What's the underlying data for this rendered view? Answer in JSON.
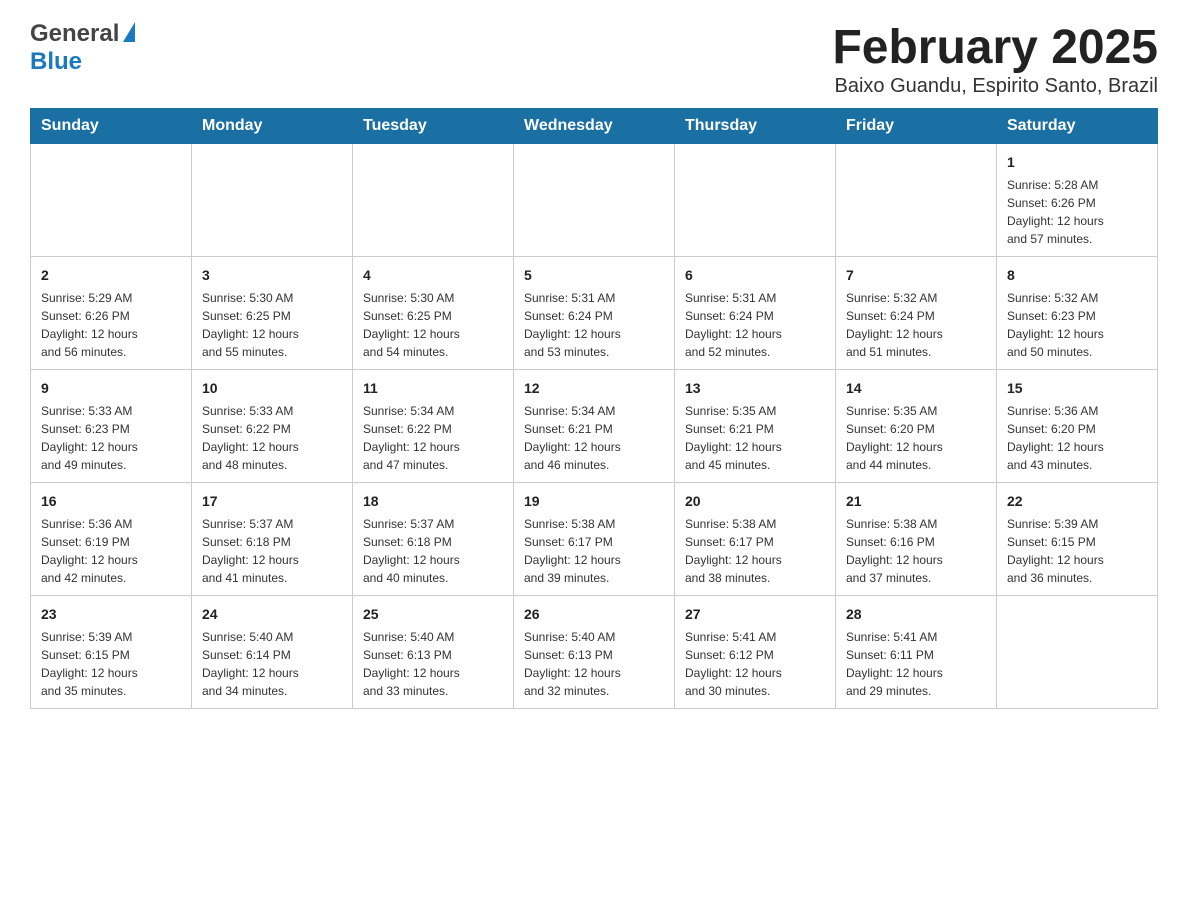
{
  "header": {
    "logo_general": "General",
    "logo_blue": "Blue",
    "title": "February 2025",
    "subtitle": "Baixo Guandu, Espirito Santo, Brazil"
  },
  "days_of_week": [
    "Sunday",
    "Monday",
    "Tuesday",
    "Wednesday",
    "Thursday",
    "Friday",
    "Saturday"
  ],
  "weeks": [
    [
      {
        "day": "",
        "info": ""
      },
      {
        "day": "",
        "info": ""
      },
      {
        "day": "",
        "info": ""
      },
      {
        "day": "",
        "info": ""
      },
      {
        "day": "",
        "info": ""
      },
      {
        "day": "",
        "info": ""
      },
      {
        "day": "1",
        "info": "Sunrise: 5:28 AM\nSunset: 6:26 PM\nDaylight: 12 hours\nand 57 minutes."
      }
    ],
    [
      {
        "day": "2",
        "info": "Sunrise: 5:29 AM\nSunset: 6:26 PM\nDaylight: 12 hours\nand 56 minutes."
      },
      {
        "day": "3",
        "info": "Sunrise: 5:30 AM\nSunset: 6:25 PM\nDaylight: 12 hours\nand 55 minutes."
      },
      {
        "day": "4",
        "info": "Sunrise: 5:30 AM\nSunset: 6:25 PM\nDaylight: 12 hours\nand 54 minutes."
      },
      {
        "day": "5",
        "info": "Sunrise: 5:31 AM\nSunset: 6:24 PM\nDaylight: 12 hours\nand 53 minutes."
      },
      {
        "day": "6",
        "info": "Sunrise: 5:31 AM\nSunset: 6:24 PM\nDaylight: 12 hours\nand 52 minutes."
      },
      {
        "day": "7",
        "info": "Sunrise: 5:32 AM\nSunset: 6:24 PM\nDaylight: 12 hours\nand 51 minutes."
      },
      {
        "day": "8",
        "info": "Sunrise: 5:32 AM\nSunset: 6:23 PM\nDaylight: 12 hours\nand 50 minutes."
      }
    ],
    [
      {
        "day": "9",
        "info": "Sunrise: 5:33 AM\nSunset: 6:23 PM\nDaylight: 12 hours\nand 49 minutes."
      },
      {
        "day": "10",
        "info": "Sunrise: 5:33 AM\nSunset: 6:22 PM\nDaylight: 12 hours\nand 48 minutes."
      },
      {
        "day": "11",
        "info": "Sunrise: 5:34 AM\nSunset: 6:22 PM\nDaylight: 12 hours\nand 47 minutes."
      },
      {
        "day": "12",
        "info": "Sunrise: 5:34 AM\nSunset: 6:21 PM\nDaylight: 12 hours\nand 46 minutes."
      },
      {
        "day": "13",
        "info": "Sunrise: 5:35 AM\nSunset: 6:21 PM\nDaylight: 12 hours\nand 45 minutes."
      },
      {
        "day": "14",
        "info": "Sunrise: 5:35 AM\nSunset: 6:20 PM\nDaylight: 12 hours\nand 44 minutes."
      },
      {
        "day": "15",
        "info": "Sunrise: 5:36 AM\nSunset: 6:20 PM\nDaylight: 12 hours\nand 43 minutes."
      }
    ],
    [
      {
        "day": "16",
        "info": "Sunrise: 5:36 AM\nSunset: 6:19 PM\nDaylight: 12 hours\nand 42 minutes."
      },
      {
        "day": "17",
        "info": "Sunrise: 5:37 AM\nSunset: 6:18 PM\nDaylight: 12 hours\nand 41 minutes."
      },
      {
        "day": "18",
        "info": "Sunrise: 5:37 AM\nSunset: 6:18 PM\nDaylight: 12 hours\nand 40 minutes."
      },
      {
        "day": "19",
        "info": "Sunrise: 5:38 AM\nSunset: 6:17 PM\nDaylight: 12 hours\nand 39 minutes."
      },
      {
        "day": "20",
        "info": "Sunrise: 5:38 AM\nSunset: 6:17 PM\nDaylight: 12 hours\nand 38 minutes."
      },
      {
        "day": "21",
        "info": "Sunrise: 5:38 AM\nSunset: 6:16 PM\nDaylight: 12 hours\nand 37 minutes."
      },
      {
        "day": "22",
        "info": "Sunrise: 5:39 AM\nSunset: 6:15 PM\nDaylight: 12 hours\nand 36 minutes."
      }
    ],
    [
      {
        "day": "23",
        "info": "Sunrise: 5:39 AM\nSunset: 6:15 PM\nDaylight: 12 hours\nand 35 minutes."
      },
      {
        "day": "24",
        "info": "Sunrise: 5:40 AM\nSunset: 6:14 PM\nDaylight: 12 hours\nand 34 minutes."
      },
      {
        "day": "25",
        "info": "Sunrise: 5:40 AM\nSunset: 6:13 PM\nDaylight: 12 hours\nand 33 minutes."
      },
      {
        "day": "26",
        "info": "Sunrise: 5:40 AM\nSunset: 6:13 PM\nDaylight: 12 hours\nand 32 minutes."
      },
      {
        "day": "27",
        "info": "Sunrise: 5:41 AM\nSunset: 6:12 PM\nDaylight: 12 hours\nand 30 minutes."
      },
      {
        "day": "28",
        "info": "Sunrise: 5:41 AM\nSunset: 6:11 PM\nDaylight: 12 hours\nand 29 minutes."
      },
      {
        "day": "",
        "info": ""
      }
    ]
  ]
}
